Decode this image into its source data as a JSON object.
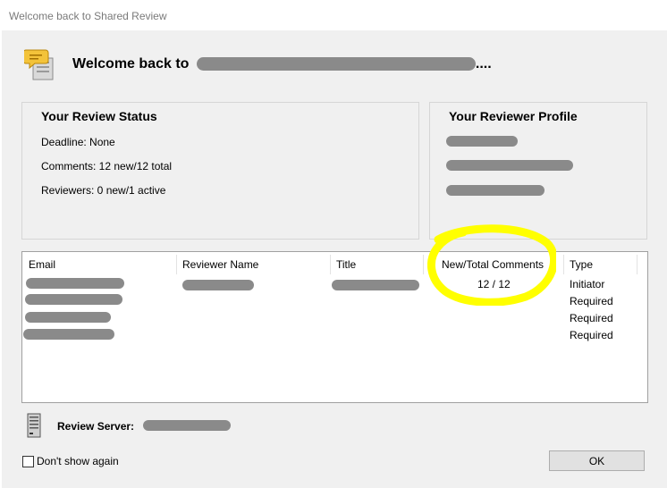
{
  "window": {
    "title": "Welcome back to Shared Review"
  },
  "header": {
    "welcome_text": "Welcome back to",
    "ellipsis": "...."
  },
  "status_panel": {
    "title": "Your Review Status",
    "deadline": "Deadline: None",
    "comments": "Comments: 12 new/12 total",
    "reviewers": "Reviewers: 0 new/1 active"
  },
  "profile_panel": {
    "title": "Your Reviewer Profile"
  },
  "table": {
    "columns": [
      "Email",
      "Reviewer Name",
      "Title",
      "New/Total Comments",
      "Type"
    ],
    "rows": [
      {
        "comments": "12 / 12",
        "type": "Initiator"
      },
      {
        "comments": "",
        "type": "Required"
      },
      {
        "comments": "",
        "type": "Required"
      },
      {
        "comments": "",
        "type": "Required"
      }
    ]
  },
  "server": {
    "label": "Review Server:"
  },
  "footer": {
    "dont_show_label": "Don't show again",
    "ok_label": "OK"
  },
  "colors": {
    "highlight": "#ffff00",
    "redaction": "#8a8a8a"
  }
}
